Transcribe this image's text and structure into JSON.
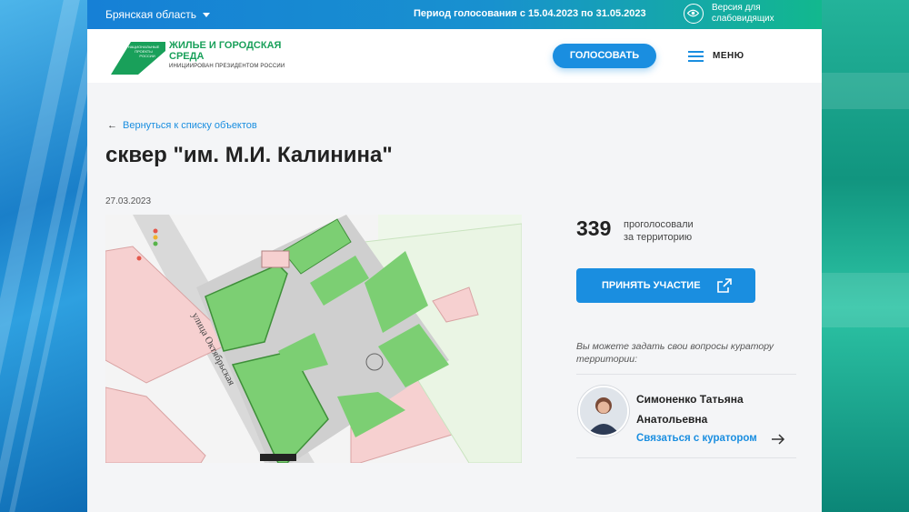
{
  "topbar": {
    "region": "Брянская область",
    "period": "Период голосования с 15.04.2023 по 31.05.2023",
    "vision_label": "Версия для слабовидящих"
  },
  "header": {
    "logo_small": "НАЦИОНАЛЬНЫЕ ПРОЕКТЫ РОССИИ",
    "logo_title": "ЖИЛЬЕ И ГОРОДСКАЯ СРЕДА",
    "logo_sub": "ИНИЦИИРОВАН ПРЕЗИДЕНТОМ РОССИИ",
    "vote_button": "ГОЛОСОВАТЬ",
    "menu_label": "МЕНЮ"
  },
  "main": {
    "back_link": "Вернуться к списку объектов",
    "title": "сквер \"им. М.И. Калинина\"",
    "date": "27.03.2023",
    "map_street_label": "улица Октябрьская"
  },
  "sidebar": {
    "votes_count": "339",
    "votes_label_1": "проголосовали",
    "votes_label_2": "за территорию",
    "join_button": "ПРИНЯТЬ УЧАСТИЕ",
    "ask_text": "Вы можете задать свои вопросы куратору территории:",
    "curator_name": "Симоненко Татьяна Анатольевна",
    "contact_link": "Связаться с куратором"
  },
  "colors": {
    "accent": "#1a8ee0",
    "brand_green": "#19a05a"
  }
}
